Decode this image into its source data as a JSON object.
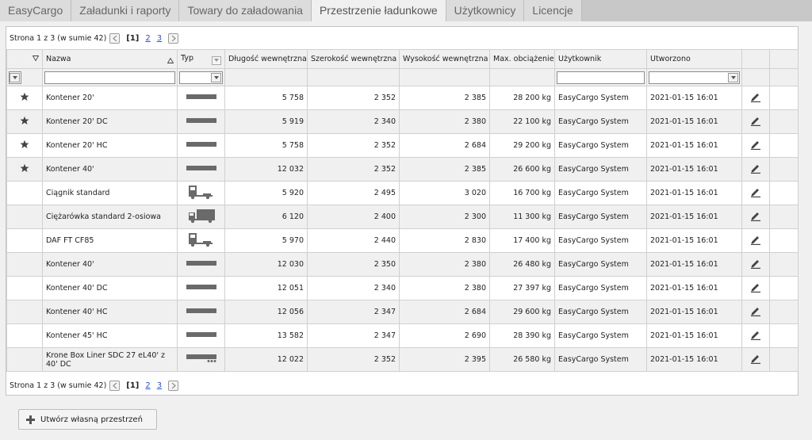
{
  "tabs": [
    {
      "label": "EasyCargo",
      "active": false
    },
    {
      "label": "Załadunki i raporty",
      "active": false
    },
    {
      "label": "Towary do załadowania",
      "active": false
    },
    {
      "label": "Przestrzenie ładunkowe",
      "active": true
    },
    {
      "label": "Użytkownicy",
      "active": false
    },
    {
      "label": "Licencje",
      "active": false
    }
  ],
  "pager": {
    "text": "Strona 1 z 3 (w sumie 42)",
    "current": "[1]",
    "page2": "2",
    "page3": "3"
  },
  "columns": {
    "name": "Nazwa",
    "type": "Typ",
    "length": "Długość wewnętrzna",
    "width": "Szerokość wewnętrzna",
    "height": "Wysokość wewnętrzna",
    "maxload": "Max. obciążenie",
    "user": "Użytkownik",
    "created": "Utworzono"
  },
  "rows": [
    {
      "fav": true,
      "name": "Kontener 20'",
      "type": "container",
      "length": "5 758",
      "width": "2 352",
      "height": "2 385",
      "maxload": "28 200 kg",
      "user": "EasyCargo System",
      "created": "2021-01-15 16:01"
    },
    {
      "fav": true,
      "name": "Kontener 20' DC",
      "type": "container",
      "length": "5 919",
      "width": "2 340",
      "height": "2 380",
      "maxload": "22 100 kg",
      "user": "EasyCargo System",
      "created": "2021-01-15 16:01"
    },
    {
      "fav": true,
      "name": "Kontener 20' HC",
      "type": "container",
      "length": "5 758",
      "width": "2 352",
      "height": "2 684",
      "maxload": "29 200 kg",
      "user": "EasyCargo System",
      "created": "2021-01-15 16:01"
    },
    {
      "fav": true,
      "name": "Kontener 40'",
      "type": "container",
      "length": "12 032",
      "width": "2 352",
      "height": "2 385",
      "maxload": "26 600 kg",
      "user": "EasyCargo System",
      "created": "2021-01-15 16:01"
    },
    {
      "fav": false,
      "name": "Ciągnik standard",
      "type": "tractor",
      "length": "5 920",
      "width": "2 495",
      "height": "3 020",
      "maxload": "16 700 kg",
      "user": "EasyCargo System",
      "created": "2021-01-15 16:01"
    },
    {
      "fav": false,
      "name": "Ciężarówka standard 2-osiowa",
      "type": "truck",
      "length": "6 120",
      "width": "2 400",
      "height": "2 300",
      "maxload": "11 300 kg",
      "user": "EasyCargo System",
      "created": "2021-01-15 16:01"
    },
    {
      "fav": false,
      "name": "DAF FT CF85",
      "type": "tractor",
      "length": "5 970",
      "width": "2 440",
      "height": "2 830",
      "maxload": "17 400 kg",
      "user": "EasyCargo System",
      "created": "2021-01-15 16:01"
    },
    {
      "fav": false,
      "name": "Kontener 40'",
      "type": "container",
      "length": "12 030",
      "width": "2 350",
      "height": "2 380",
      "maxload": "26 480 kg",
      "user": "EasyCargo System",
      "created": "2021-01-15 16:01"
    },
    {
      "fav": false,
      "name": "Kontener 40' DC",
      "type": "container",
      "length": "12 051",
      "width": "2 340",
      "height": "2 380",
      "maxload": "27 397 kg",
      "user": "EasyCargo System",
      "created": "2021-01-15 16:01"
    },
    {
      "fav": false,
      "name": "Kontener 40' HC",
      "type": "container",
      "length": "12 056",
      "width": "2 347",
      "height": "2 684",
      "maxload": "29 600 kg",
      "user": "EasyCargo System",
      "created": "2021-01-15 16:01"
    },
    {
      "fav": false,
      "name": "Kontener 45' HC",
      "type": "container",
      "length": "13 582",
      "width": "2 347",
      "height": "2 690",
      "maxload": "28 390 kg",
      "user": "EasyCargo System",
      "created": "2021-01-15 16:01"
    },
    {
      "fav": false,
      "name": "Krone Box Liner SDC 27 eL40' z 40' DC",
      "type": "trailer",
      "length": "12 022",
      "width": "2 352",
      "height": "2 395",
      "maxload": "26 580 kg",
      "user": "EasyCargo System",
      "created": "2021-01-15 16:01"
    }
  ],
  "create_button": "Utwórz własną przestrzeń",
  "icons": {
    "favorite": "star-icon",
    "edit": "pencil-icon",
    "add": "plus-icon"
  },
  "colors": {
    "link": "#2a55c8",
    "icon": "#555555"
  }
}
